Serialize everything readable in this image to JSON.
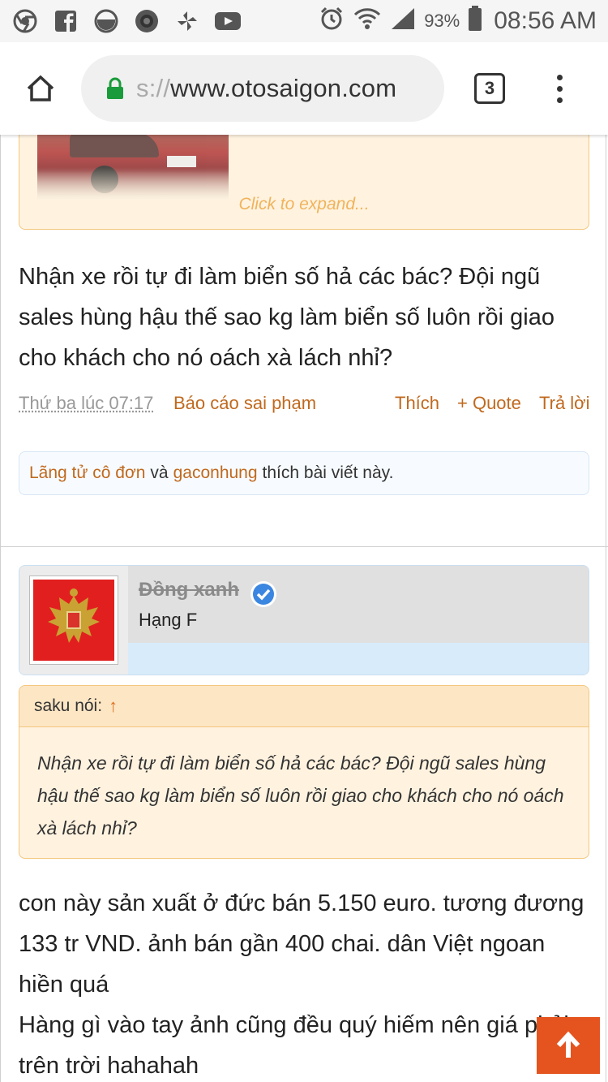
{
  "status_bar": {
    "icons": [
      "chrome-icon",
      "facebook-icon",
      "app-icon",
      "camera-icon",
      "pinwheel-icon",
      "youtube-icon"
    ],
    "battery": "93%",
    "time": "08:56 AM"
  },
  "browser": {
    "url_prefix": "s://",
    "url_domain": "www.otosaigon.com",
    "tab_count": "3"
  },
  "prev_post": {
    "expand_link": "Click to expand...",
    "text": "Nhận xe rồi tự đi làm biển số hả các bác? Đội ngũ sales hùng hậu thế sao kg làm biển số luôn rồi giao cho khách cho nó oách xà lách nhỉ?",
    "date": "Thứ ba lúc 07:17",
    "report": "Báo cáo sai phạm",
    "like": "Thích",
    "quote": "+ Quote",
    "reply": "Trả lời",
    "likers": [
      "Lãng tử cô đơn",
      "gaconhung"
    ],
    "likes_joiner": "và",
    "likes_suffix": "thích bài viết này."
  },
  "post": {
    "user_name": "Đồng xanh",
    "user_rank": "Hạng F",
    "quote_author": "saku nói:",
    "quote_arrow": "↑",
    "quote_text": "Nhận xe rồi tự đi làm biển số hả các bác? Đội ngũ sales hùng hậu thế sao kg làm biển số luôn rồi giao cho khách cho nó oách xà lách nhỉ?",
    "text_line1": "con này sản xuất ở đức bán 5.150 euro. tương đương 133 tr VND. ảnh bán gần 400 chai. dân Việt ngoan hiền quá",
    "text_line2": "Hàng gì vào tay ảnh cũng đều quý hiếm nên giá phải trên trời hahahah"
  },
  "colors": {
    "link_orange": "#c0691e",
    "quote_bg": "#fff3e0",
    "scroll_button": "#e5541f"
  }
}
